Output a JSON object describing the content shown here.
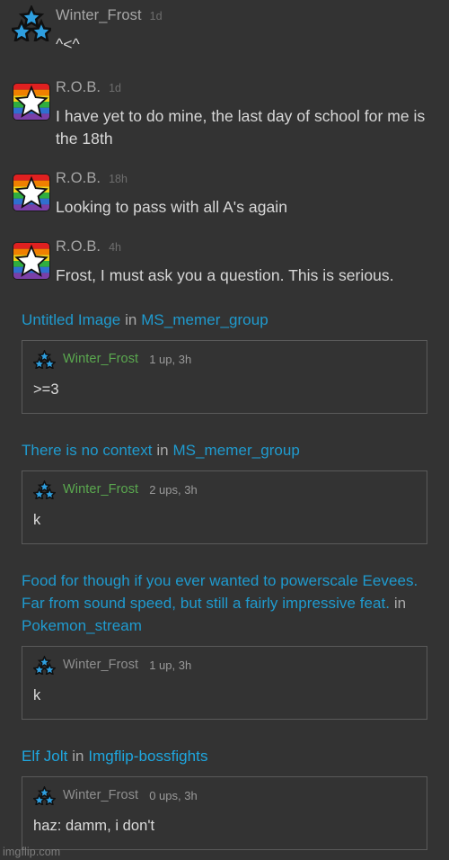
{
  "theme": {
    "background": "#333333",
    "link_color": "#1f9bcf",
    "link_color_bright": "#1ea7e0",
    "username_green": "#5aa84f",
    "username_gray": "#8f8f8f",
    "card_border": "#5a5a5a",
    "body_text": "#d8d8d8",
    "meta_text": "#6e6e6e"
  },
  "messages": [
    {
      "avatar": "three-stars-avatar",
      "username": "Winter_Frost",
      "time": "1d",
      "body": "^<^"
    },
    {
      "avatar": "rainbow-star-avatar",
      "username": "R.O.B.",
      "time": "1d",
      "body": "I have yet to do mine, the last day of school for me is the 18th"
    },
    {
      "avatar": "rainbow-star-avatar",
      "username": "R.O.B.",
      "time": "18h",
      "body": "Looking to pass with all A's again"
    },
    {
      "avatar": "rainbow-star-avatar",
      "username": "R.O.B.",
      "time": "4h",
      "body": "Frost, I must ask you a question. This is serious."
    }
  ],
  "notifications": [
    {
      "post_title": "Untitled Image",
      "conjunction": "in",
      "stream": "MS_memer_group",
      "comment": {
        "avatar": "three-stars-avatar",
        "username": "Winter_Frost",
        "username_highlighted": true,
        "meta": "1 up, 3h",
        "body": ">=3"
      }
    },
    {
      "post_title": "There is no context",
      "conjunction": "in",
      "stream": "MS_memer_group",
      "comment": {
        "avatar": "three-stars-avatar",
        "username": "Winter_Frost",
        "username_highlighted": true,
        "meta": "2 ups, 3h",
        "body": "k"
      }
    },
    {
      "post_title": "Food for though if you ever wanted to powerscale Eevees. Far from sound speed, but still a fairly impressive feat.",
      "conjunction": "in",
      "stream": "Pokemon_stream",
      "comment": {
        "avatar": "three-stars-avatar",
        "username": "Winter_Frost",
        "username_highlighted": false,
        "meta": "1 up, 3h",
        "body": "k"
      }
    },
    {
      "post_title": "Elf Jolt",
      "conjunction": "in",
      "stream": "Imgflip-bossfights",
      "comment": {
        "avatar": "three-stars-avatar",
        "username": "Winter_Frost",
        "username_highlighted": false,
        "meta": "0 ups, 3h",
        "body": "haz: damm, i don't"
      }
    }
  ],
  "watermark": "imgflip.com"
}
